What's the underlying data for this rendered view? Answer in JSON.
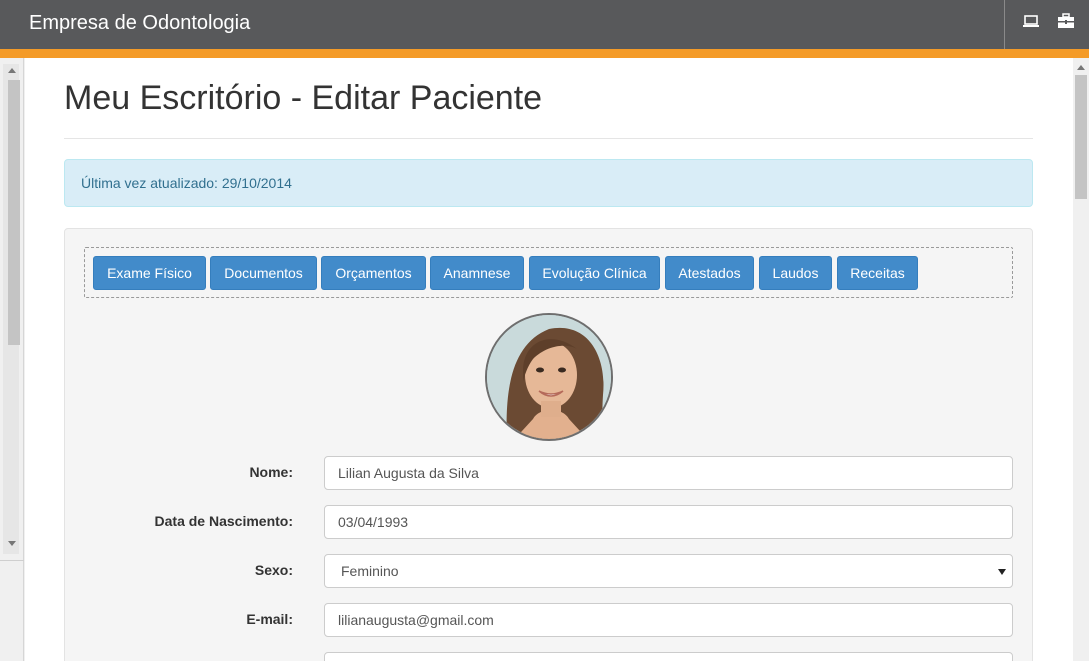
{
  "header": {
    "brand": "Empresa de Odontologia",
    "icons": [
      "laptop-icon",
      "briefcase-icon"
    ],
    "accent_color": "#f49b28"
  },
  "page": {
    "title": "Meu Escritório - Editar Paciente",
    "alert_text": "Última vez atualizado: 29/10/2014"
  },
  "tabs": [
    {
      "label": "Exame Físico"
    },
    {
      "label": "Documentos"
    },
    {
      "label": "Orçamentos"
    },
    {
      "label": "Anamnese"
    },
    {
      "label": "Evolução Clínica"
    },
    {
      "label": "Atestados"
    },
    {
      "label": "Laudos"
    },
    {
      "label": "Receitas"
    }
  ],
  "form": {
    "nome": {
      "label": "Nome:",
      "value": "Lilian Augusta da Silva"
    },
    "nascimento": {
      "label": "Data de Nascimento:",
      "value": "03/04/1993"
    },
    "sexo": {
      "label": "Sexo:",
      "value": "Feminino"
    },
    "email": {
      "label": "E-mail:",
      "value": "lilianaugusta@gmail.com"
    }
  },
  "colors": {
    "topbar": "#58595b",
    "button": "#428bca",
    "alert_bg": "#d9edf7"
  }
}
